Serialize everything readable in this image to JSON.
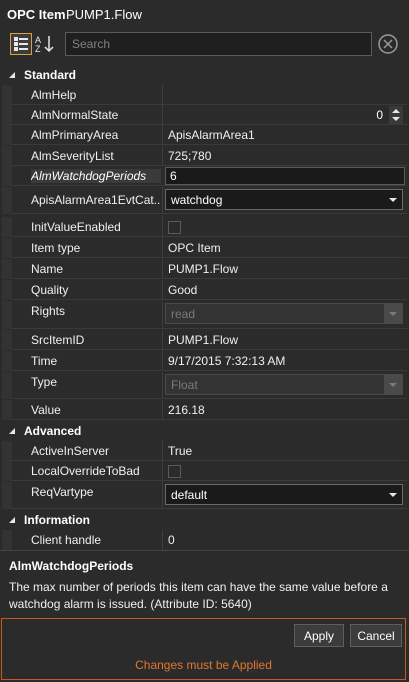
{
  "header": {
    "title": "OPC Item",
    "item_name": "PUMP1.Flow"
  },
  "toolbar": {
    "search_placeholder": "Search"
  },
  "categories": {
    "standard": "Standard",
    "advanced": "Advanced",
    "information": "Information"
  },
  "standard": {
    "alm_help": {
      "label": "AlmHelp",
      "value": ""
    },
    "alm_normal_state": {
      "label": "AlmNormalState",
      "value": "0"
    },
    "alm_primary_area": {
      "label": "AlmPrimaryArea",
      "value": "ApisAlarmArea1"
    },
    "alm_severity_list": {
      "label": "AlmSeverityList",
      "value": "725;780"
    },
    "alm_watchdog_periods": {
      "label": "AlmWatchdogPeriods",
      "value": "6"
    },
    "apis_alarm_area_evt": {
      "label": "ApisAlarmArea1EvtCat...",
      "value": "watchdog"
    },
    "init_value_enabled": {
      "label": "InitValueEnabled"
    },
    "item_type": {
      "label": "Item type",
      "value": "OPC Item"
    },
    "name": {
      "label": "Name",
      "value": "PUMP1.Flow"
    },
    "quality": {
      "label": "Quality",
      "value": "Good"
    },
    "rights": {
      "label": "Rights",
      "value": "read"
    },
    "src_item_id": {
      "label": "SrcItemID",
      "value": "PUMP1.Flow"
    },
    "time": {
      "label": "Time",
      "value": "9/17/2015 7:32:13 AM"
    },
    "type": {
      "label": "Type",
      "value": "Float"
    },
    "value": {
      "label": "Value",
      "value": "216.18"
    }
  },
  "advanced": {
    "active_in_server": {
      "label": "ActiveInServer",
      "value": "True"
    },
    "local_override": {
      "label": "LocalOverrideToBad"
    },
    "req_vartype": {
      "label": "ReqVartype",
      "value": "default"
    }
  },
  "information": {
    "client_handle": {
      "label": "Client handle",
      "value": "0"
    }
  },
  "description": {
    "title": "AlmWatchdogPeriods",
    "text": "The max number of periods this item can have the same value before a watchdog alarm is issued. (Attribute ID: 5640)"
  },
  "footer": {
    "apply_label": "Apply",
    "cancel_label": "Cancel",
    "message": "Changes must be Applied"
  },
  "colors": {
    "accent_orange": "#c75b1f",
    "message_orange": "#e0782e",
    "background": "#2b2b2b"
  }
}
